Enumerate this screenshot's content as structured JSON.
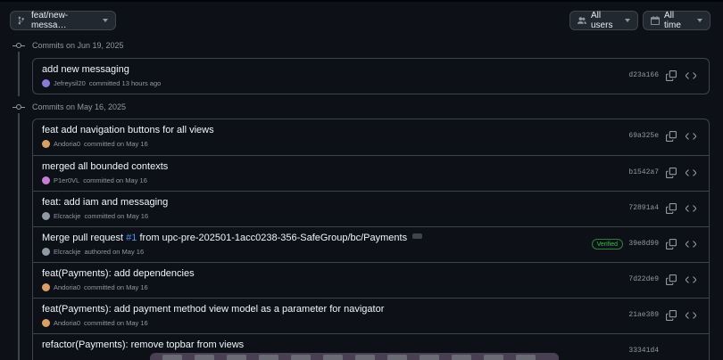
{
  "toolbar": {
    "branch": "feat/new-messa…",
    "users": "All users",
    "time": "All time"
  },
  "groups": [
    {
      "label": "Commits on Jun 19, 2025",
      "commits": [
        {
          "title": "add new messaging",
          "author": "Jefreysil20",
          "action": "committed 13 hours ago",
          "sha": "d23a166",
          "avatar_color": "#8a7bd6"
        }
      ]
    },
    {
      "label": "Commits on May 16, 2025",
      "commits": [
        {
          "title": "feat add navigation buttons for all views",
          "author": "Andoria0",
          "action": "committed on May 16",
          "sha": "69a325e",
          "avatar_color": "#d9a066"
        },
        {
          "title": "merged all bounded contexts",
          "author": "P1er0VL",
          "action": "committed on May 16",
          "sha": "b1542a7",
          "avatar_color": "#c77dd4"
        },
        {
          "title": "feat: add iam and messaging",
          "author": "Elcrackje",
          "action": "committed on May 16",
          "sha": "72891a4",
          "avatar_color": "#8f9aa3"
        },
        {
          "title_pre": "Merge pull request ",
          "pr": "#1",
          "title_post": " from upc-pre-202501-1acc0238-356-SafeGroup/bc/Payments",
          "author": "Elcrackje",
          "action": "authored on May 16",
          "sha": "39e8d99",
          "badge": "Verified",
          "avatar_color": "#8f9aa3"
        },
        {
          "title": "feat(Payments): add dependencies",
          "author": "Andoria0",
          "action": "committed on May 16",
          "sha": "7d22de9",
          "avatar_color": "#d9a066"
        },
        {
          "title": "feat(Payments): add payment method view model as a parameter for navigator",
          "author": "Andoria0",
          "action": "committed on May 16",
          "sha": "21ae389",
          "avatar_color": "#d9a066"
        },
        {
          "title": "refactor(Payments): remove topbar from views",
          "author": "",
          "action": "",
          "sha": "33341d4",
          "avatar_color": "#d9a066"
        }
      ]
    }
  ]
}
